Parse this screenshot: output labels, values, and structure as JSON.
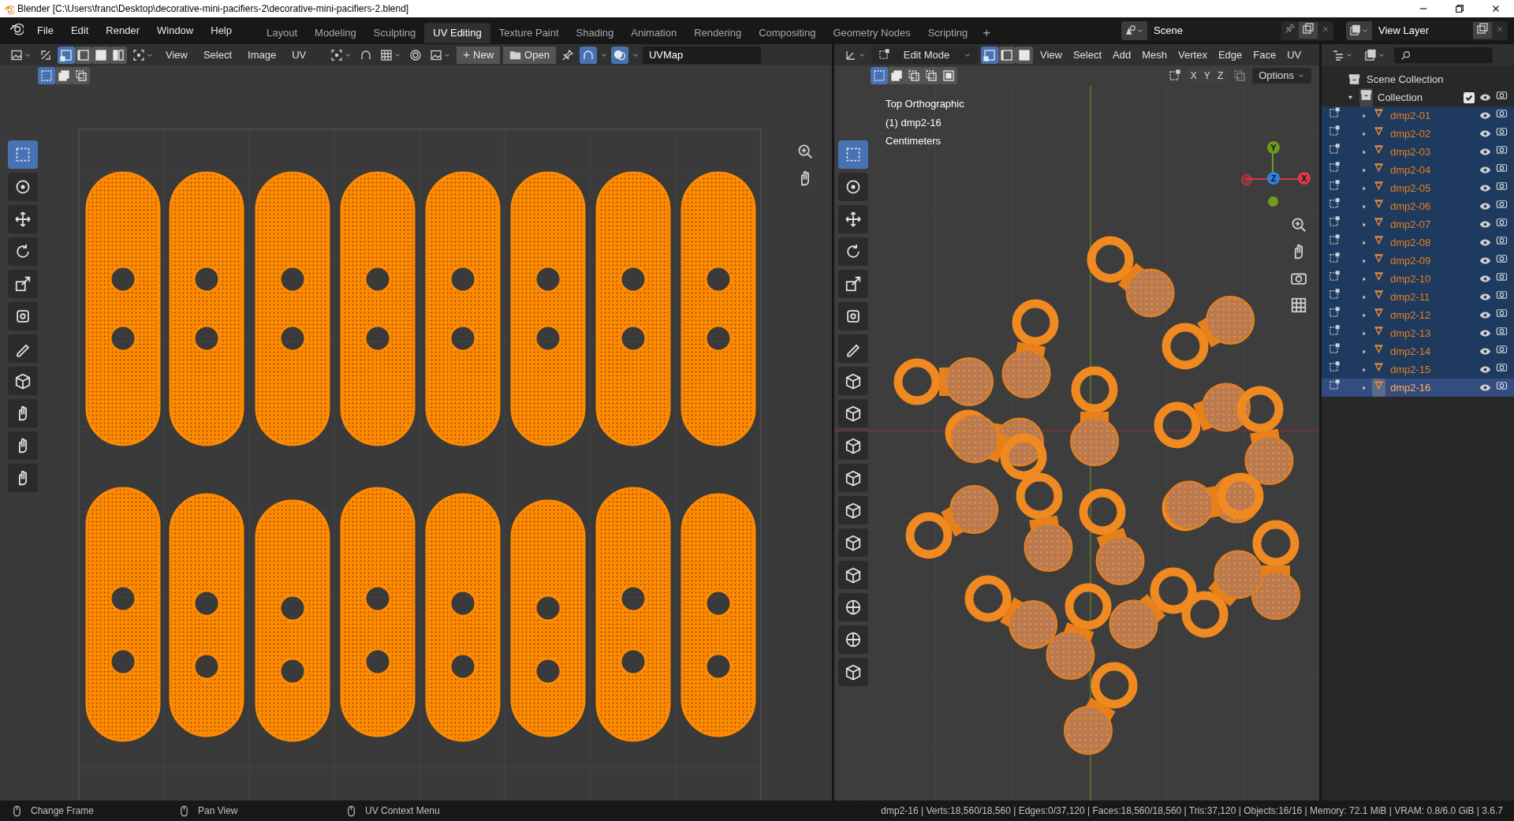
{
  "window": {
    "title": "Blender [C:\\Users\\franc\\Desktop\\decorative-mini-pacifiers-2\\decorative-mini-pacifiers-2.blend]"
  },
  "menu": [
    "File",
    "Edit",
    "Render",
    "Window",
    "Help"
  ],
  "workspaces": [
    {
      "label": "Layout",
      "selected": false
    },
    {
      "label": "Modeling",
      "selected": false
    },
    {
      "label": "Sculpting",
      "selected": false
    },
    {
      "label": "UV Editing",
      "selected": true
    },
    {
      "label": "Texture Paint",
      "selected": false
    },
    {
      "label": "Shading",
      "selected": false
    },
    {
      "label": "Animation",
      "selected": false
    },
    {
      "label": "Rendering",
      "selected": false
    },
    {
      "label": "Compositing",
      "selected": false
    },
    {
      "label": "Geometry Nodes",
      "selected": false
    },
    {
      "label": "Scripting",
      "selected": false
    }
  ],
  "add_workspace": "+",
  "scene": {
    "value": "Scene"
  },
  "view_layer": {
    "value": "View Layer"
  },
  "uv_editor": {
    "select_modes": [
      {
        "selected": true
      },
      {
        "selected": false
      },
      {
        "selected": false
      },
      {
        "selected": false
      }
    ],
    "menus": [
      "View",
      "Select",
      "Image",
      "UV"
    ],
    "buttons": [
      {
        "kind": "new",
        "label": "New",
        "icon": "+"
      },
      {
        "kind": "open",
        "label": "Open"
      }
    ],
    "uv_map": "UVMap",
    "box_modes": [
      {
        "selected": true
      },
      {
        "selected": false
      },
      {
        "selected": false
      }
    ],
    "tools": [
      {
        "selected": true
      },
      {
        "selected": false
      },
      {
        "selected": false
      },
      {
        "selected": false
      },
      {
        "selected": false
      },
      {
        "selected": false
      },
      {
        "selected": false
      },
      {
        "selected": false
      },
      {
        "selected": false
      },
      {
        "selected": false
      },
      {
        "selected": false
      }
    ]
  },
  "viewport": {
    "mode": "Edit Mode",
    "select_modes": [
      {
        "selected": true
      },
      {
        "selected": false
      },
      {
        "selected": false
      }
    ],
    "menus": [
      "View",
      "Select",
      "Add",
      "Mesh",
      "Vertex",
      "Edge",
      "Face",
      "UV"
    ],
    "box_modes": [
      {
        "selected": true
      },
      {
        "selected": false
      },
      {
        "selected": false
      },
      {
        "selected": false
      },
      {
        "selected": false
      }
    ],
    "axes": [
      "X",
      "Y",
      "Z"
    ],
    "options": "Options",
    "overlay": [
      "Top Orthographic",
      "(1) dmp2-16",
      "Centimeters"
    ],
    "gizmo": [
      {
        "label": "Y",
        "color": "#6e9a1e"
      },
      {
        "label": "Z",
        "color": "#2f82d9"
      },
      {
        "label": "X",
        "color": "#d93a48"
      }
    ],
    "tools": [
      {
        "selected": true
      },
      {
        "selected": false
      },
      {
        "selected": false
      },
      {
        "selected": false
      },
      {
        "selected": false
      },
      {
        "selected": false
      },
      {
        "selected": false
      },
      {
        "selected": false
      },
      {
        "selected": false
      },
      {
        "selected": false
      },
      {
        "selected": false
      },
      {
        "selected": false
      },
      {
        "selected": false
      },
      {
        "selected": false
      },
      {
        "selected": false
      },
      {
        "selected": false
      },
      {
        "selected": false
      }
    ]
  },
  "outliner": {
    "root": "Scene Collection",
    "collection": {
      "label": "Collection",
      "expanded": true,
      "checked": true,
      "children": [
        {
          "label": "dmp2-01",
          "selected": true,
          "active": false
        },
        {
          "label": "dmp2-02",
          "selected": true,
          "active": false
        },
        {
          "label": "dmp2-03",
          "selected": true,
          "active": false
        },
        {
          "label": "dmp2-04",
          "selected": true,
          "active": false
        },
        {
          "label": "dmp2-05",
          "selected": true,
          "active": false
        },
        {
          "label": "dmp2-06",
          "selected": true,
          "active": false
        },
        {
          "label": "dmp2-07",
          "selected": true,
          "active": false
        },
        {
          "label": "dmp2-08",
          "selected": true,
          "active": false
        },
        {
          "label": "dmp2-09",
          "selected": true,
          "active": false
        },
        {
          "label": "dmp2-10",
          "selected": true,
          "active": false
        },
        {
          "label": "dmp2-11",
          "selected": true,
          "active": false
        },
        {
          "label": "dmp2-12",
          "selected": true,
          "active": false
        },
        {
          "label": "dmp2-13",
          "selected": true,
          "active": false
        },
        {
          "label": "dmp2-14",
          "selected": true,
          "active": false
        },
        {
          "label": "dmp2-15",
          "selected": true,
          "active": false
        },
        {
          "label": "dmp2-16",
          "selected": true,
          "active": true
        }
      ]
    }
  },
  "status_bar": {
    "hints": [
      "Change Frame",
      "Pan View",
      "UV Context Menu"
    ],
    "stats": "dmp2-16 | Verts:18,560/18,560 | Edges:0/37,120 | Faces:18,560/18,560 | Tris:37,120 | Objects:16/16 | Memory: 72.1 MiB | VRAM: 0.8/6.0 GiB | 3.6.7"
  }
}
